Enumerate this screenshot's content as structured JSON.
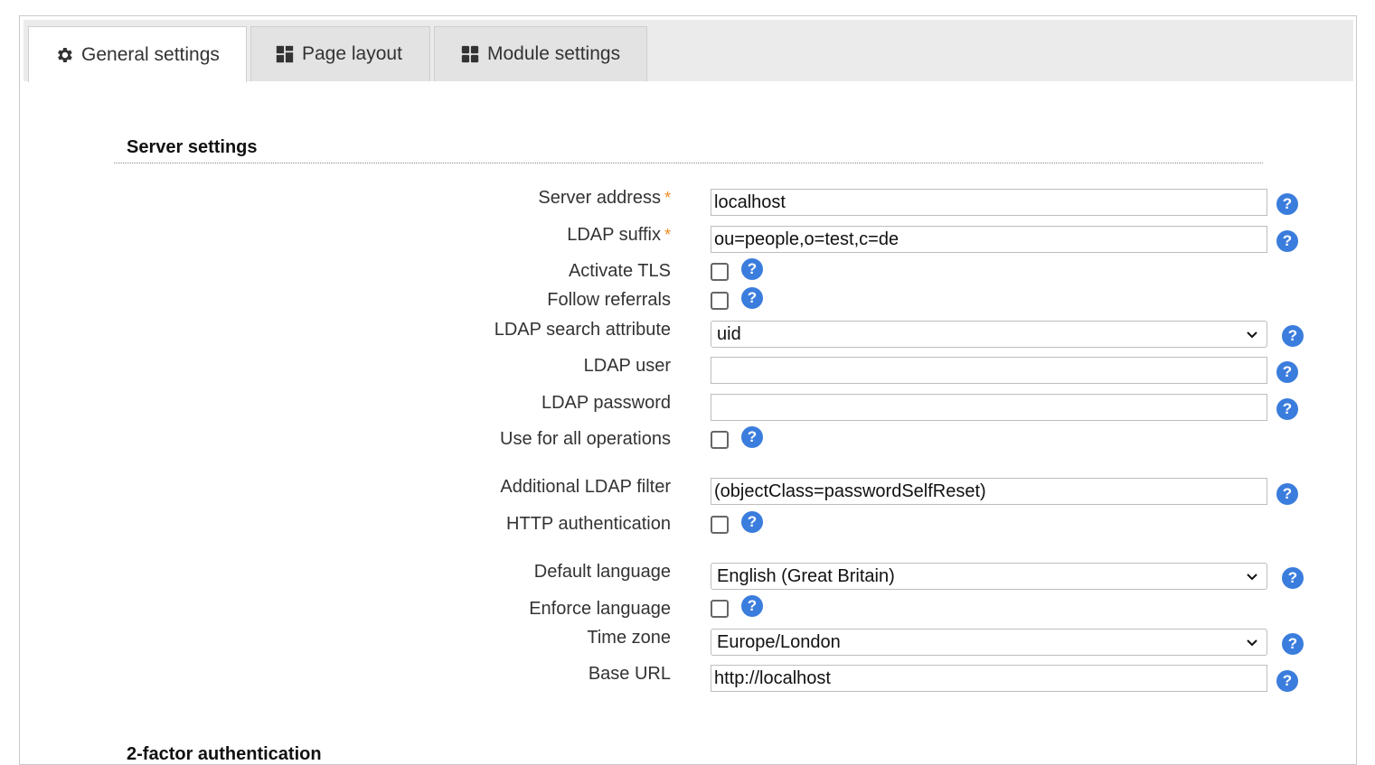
{
  "tabs": [
    {
      "label": "General settings",
      "icon": "gear-icon",
      "active": true
    },
    {
      "label": "Page layout",
      "icon": "layout-icon",
      "active": false
    },
    {
      "label": "Module settings",
      "icon": "modules-icon",
      "active": false
    }
  ],
  "section": {
    "title": "Server settings"
  },
  "fields": {
    "server_address": {
      "label": "Server address",
      "value": "localhost",
      "required_mark": "*"
    },
    "ldap_suffix": {
      "label": "LDAP suffix",
      "value": "ou=people,o=test,c=de",
      "required_mark": "*"
    },
    "activate_tls": {
      "label": "Activate TLS"
    },
    "follow_referrals": {
      "label": "Follow referrals"
    },
    "search_attribute": {
      "label": "LDAP search attribute",
      "value": "uid"
    },
    "ldap_user": {
      "label": "LDAP user",
      "value": ""
    },
    "ldap_password": {
      "label": "LDAP password",
      "value": ""
    },
    "use_for_all": {
      "label": "Use for all operations"
    },
    "additional_filter": {
      "label": "Additional LDAP filter",
      "value": "(objectClass=passwordSelfReset)"
    },
    "http_auth": {
      "label": "HTTP authentication"
    },
    "default_language": {
      "label": "Default language",
      "value": "English (Great Britain)"
    },
    "enforce_language": {
      "label": "Enforce language"
    },
    "time_zone": {
      "label": "Time zone",
      "value": "Europe/London"
    },
    "base_url": {
      "label": "Base URL",
      "value": "http://localhost"
    }
  },
  "help_glyph": "?",
  "next_section": {
    "title": "2-factor authentication"
  },
  "colors": {
    "accent": "#3b7ddd",
    "required": "#f08a1c"
  }
}
